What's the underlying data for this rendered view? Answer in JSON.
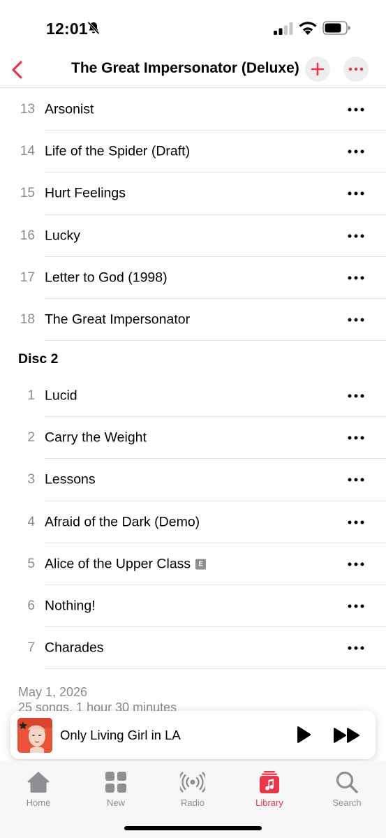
{
  "status_bar": {
    "time": "12:01"
  },
  "nav": {
    "title": "The Great Impersonator (Deluxe)",
    "accent_color": "#e8374b"
  },
  "disc1_tracks": [
    {
      "number": "13",
      "title": "Arsonist"
    },
    {
      "number": "14",
      "title": "Life of the Spider (Draft)"
    },
    {
      "number": "15",
      "title": "Hurt Feelings"
    },
    {
      "number": "16",
      "title": "Lucky"
    },
    {
      "number": "17",
      "title": "Letter to God (1998)"
    },
    {
      "number": "18",
      "title": "The Great Impersonator"
    }
  ],
  "disc2_header": "Disc 2",
  "disc2_tracks": [
    {
      "number": "1",
      "title": "Lucid"
    },
    {
      "number": "2",
      "title": "Carry the Weight"
    },
    {
      "number": "3",
      "title": "Lessons"
    },
    {
      "number": "4",
      "title": "Afraid of the Dark (Demo)"
    },
    {
      "number": "5",
      "title": "Alice of the Upper Class",
      "explicit": "E"
    },
    {
      "number": "6",
      "title": "Nothing!"
    },
    {
      "number": "7",
      "title": "Charades"
    }
  ],
  "footer": {
    "date": "May 1, 2026",
    "summary": "25 songs, 1 hour 30 minutes"
  },
  "mini_player": {
    "title": "Only Living Girl in LA"
  },
  "tabs": [
    {
      "label": "Home",
      "icon": "house-icon"
    },
    {
      "label": "New",
      "icon": "grid-icon"
    },
    {
      "label": "Radio",
      "icon": "radio-waves-icon"
    },
    {
      "label": "Library",
      "icon": "library-music-icon",
      "active": true
    },
    {
      "label": "Search",
      "icon": "magnifier-icon"
    }
  ]
}
